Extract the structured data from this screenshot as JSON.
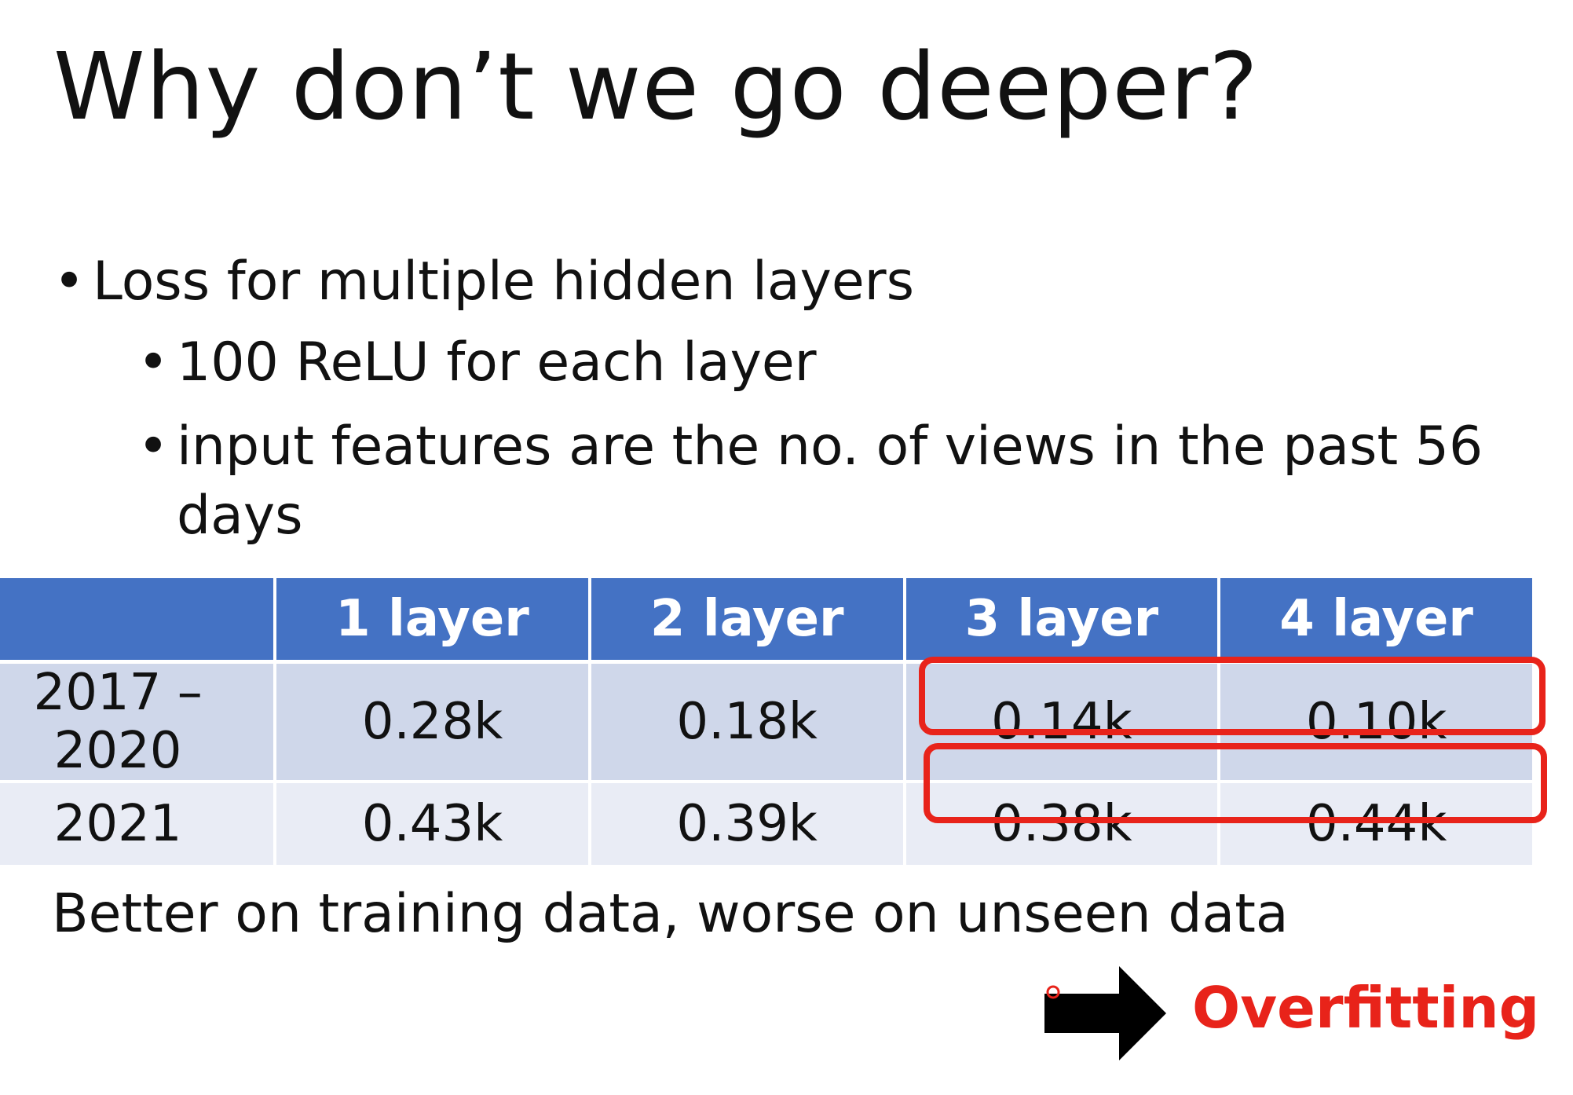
{
  "slide": {
    "title": "Why don’t we go deeper?",
    "bullet_main": "Loss for multiple hidden layers",
    "sub_bullets": [
      "100 ReLU for each layer",
      "input features are the no. of views in the past 56",
      "days"
    ],
    "bullet_marker": "•",
    "table": {
      "headers": [
        "",
        "1 layer",
        "2 layer",
        "3 layer",
        "4 layer"
      ],
      "rows": [
        [
          "2017 – 2020",
          "0.28k",
          "0.18k",
          "0.14k",
          "0.10k"
        ],
        [
          "2021",
          "0.43k",
          "0.39k",
          "0.38k",
          "0.44k"
        ]
      ]
    },
    "conclusion": "Better on training data, worse on unseen data",
    "result_label": "Overfitting"
  },
  "colors": {
    "header_blue": "#4472c4",
    "row_dark": "#cfd7ea",
    "row_light": "#e9ecf5",
    "highlight_red": "#e8231a"
  },
  "icons": {
    "arrow": "right-arrow-icon"
  }
}
